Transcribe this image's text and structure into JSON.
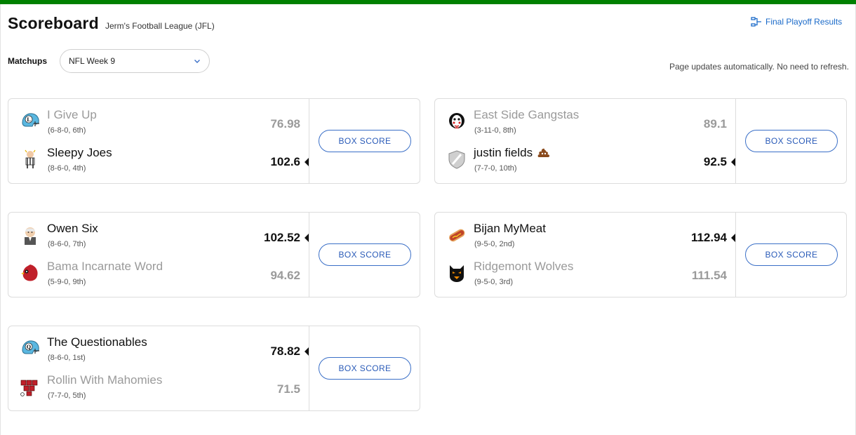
{
  "header": {
    "title": "Scoreboard",
    "league": "Jerm's Football League (JFL)",
    "playoff_link": "Final Playoff Results",
    "matchups_label": "Matchups",
    "week_selected": "NFL Week 9",
    "auto_note": "Page updates automatically. No need to refresh."
  },
  "colors": {
    "accent_bar": "#008000",
    "link": "#1a6ac9"
  },
  "box_score_label": "BOX SCORE",
  "matchups": [
    {
      "teams": [
        {
          "name": "I Give Up",
          "record": "(6-8-0, 6th)",
          "score": "76.98",
          "winner": false,
          "icon": "helmet-L-icon"
        },
        {
          "name": "Sleepy Joes",
          "record": "(8-6-0, 4th)",
          "score": "102.6",
          "winner": true,
          "icon": "referee-icon"
        }
      ]
    },
    {
      "teams": [
        {
          "name": "East Side Gangstas",
          "record": "(3-11-0, 8th)",
          "score": "89.1",
          "winner": false,
          "icon": "clown-icon"
        },
        {
          "name": "justin fields",
          "record": "(7-7-0, 10th)",
          "score": "92.5",
          "winner": true,
          "icon": "shield-icon",
          "emoji": "poop-icon"
        }
      ]
    },
    {
      "teams": [
        {
          "name": "Owen Six",
          "record": "(8-6-0, 7th)",
          "score": "102.52",
          "winner": true,
          "icon": "old-man-icon"
        },
        {
          "name": "Bama Incarnate Word",
          "record": "(5-9-0, 9th)",
          "score": "94.62",
          "winner": false,
          "icon": "cardinal-icon"
        }
      ]
    },
    {
      "teams": [
        {
          "name": "Bijan MyMeat",
          "record": "(9-5-0, 2nd)",
          "score": "112.94",
          "winner": true,
          "icon": "hotdog-icon"
        },
        {
          "name": "Ridgemont Wolves",
          "record": "(9-5-0, 3rd)",
          "score": "111.54",
          "winner": false,
          "icon": "wolf-icon"
        }
      ]
    },
    {
      "teams": [
        {
          "name": "The Questionables",
          "record": "(8-6-0, 1st)",
          "score": "78.82",
          "winner": true,
          "icon": "helmet-Q-icon"
        },
        {
          "name": "Rollin With Mahomies",
          "record": "(7-7-0, 5th)",
          "score": "71.5",
          "winner": false,
          "icon": "cups-icon"
        }
      ]
    }
  ]
}
